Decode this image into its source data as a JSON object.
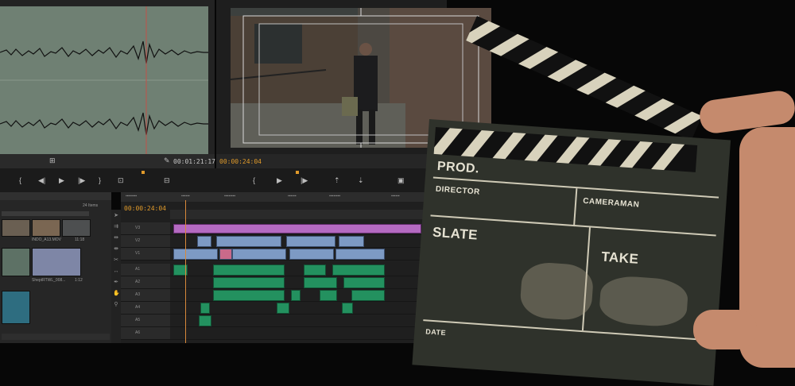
{
  "source_monitor": {
    "timecode": "00:01:21:17"
  },
  "program_monitor": {
    "timecode": "00:00:24:04"
  },
  "timeline": {
    "timecode": "00:00:24:04",
    "track_labels": [
      "V3",
      "V2",
      "V1",
      "A1",
      "A2",
      "A3",
      "A4",
      "A5",
      "A6"
    ]
  },
  "project_panel": {
    "item_count": "24 Items",
    "clips": [
      {
        "name": "INDO_A13.MOV",
        "duration": "11:18"
      },
      {
        "name": "SheptRTWL_008...",
        "duration": "1:12"
      }
    ]
  },
  "clapperboard": {
    "prod_label": "PROD.",
    "director_label": "DIRECTOR",
    "cameraman_label": "CAMERAMAN",
    "slate_label": "SLATE",
    "take_label": "TAKE",
    "date_label": "DATE"
  },
  "colors": {
    "waveform_bg": "#6f8073",
    "video_clip": "#7d9ac4",
    "audio_clip": "#23915f",
    "title_clip": "#b46ac1",
    "timecode": "#e09a2a"
  }
}
